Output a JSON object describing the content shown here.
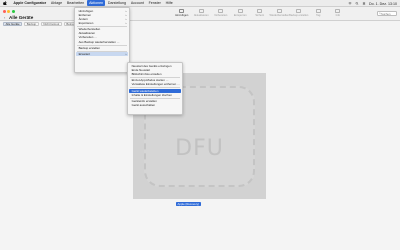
{
  "menubar": {
    "app_name": "Apple Configurator",
    "items": [
      "Ablage",
      "Bearbeiten",
      "Aktionen",
      "Darstellung",
      "Account",
      "Fenster",
      "Hilfe"
    ],
    "clock": "Do. 1. Dez. 13:10"
  },
  "window": {
    "title": "Alle Geräte",
    "toolbar": [
      {
        "label": "Hinzufügen",
        "dim": false
      },
      {
        "label": "Aktualisieren",
        "dim": true
      },
      {
        "label": "Vorbereiten",
        "dim": true
      },
      {
        "label": "Entsperren",
        "dim": true
      },
      {
        "label": "Sichern",
        "dim": true
      },
      {
        "label": "Wiederherstellen",
        "dim": true
      },
      {
        "label": "Backup erstellen",
        "dim": true
      },
      {
        "label": "Tag",
        "dim": true
      },
      {
        "label": "Info",
        "dim": true
      }
    ],
    "search_placeholder": "Suchen"
  },
  "filters": [
    "Alle Geräte",
    "Backup",
    "Nicht betreut",
    "Betreut",
    "Wiederherst.",
    "Sonstige"
  ],
  "primary_menu": [
    {
      "label": "Hinzufügen",
      "arrow": true,
      "dim": false
    },
    {
      "label": "Entfernen",
      "arrow": true,
      "dim": false
    },
    {
      "label": "Ändern",
      "arrow": true,
      "dim": false
    },
    {
      "label": "Exportieren",
      "arrow": true,
      "dim": false
    },
    {
      "sep": true
    },
    {
      "label": "Wiederherstellen",
      "arrow": false,
      "dim": false
    },
    {
      "label": "Aktualisieren",
      "arrow": false,
      "dim": false
    },
    {
      "label": "Vorbereiten …",
      "arrow": false,
      "dim": false
    },
    {
      "label": "Aus Backup wiederherstellen …",
      "arrow": false,
      "dim": false
    },
    {
      "sep": true
    },
    {
      "label": "Backup erstellen",
      "arrow": false,
      "dim": false
    },
    {
      "sep": true
    },
    {
      "label": "Erweitert",
      "arrow": true,
      "dim": false,
      "active": true
    }
  ],
  "submenu": [
    {
      "label": "Neustart des Geräts erzwingen",
      "dim": false
    },
    {
      "label": "Ende Neustart",
      "dim": false
    },
    {
      "label": "Bildschirmfoto erstellen",
      "dim": false
    },
    {
      "sep": true
    },
    {
      "label": "Einzel-App-Modus starten …",
      "dim": false
    },
    {
      "label": "Verwaltete Einstellungen entfernen …",
      "dim": false
    },
    {
      "sep": true
    },
    {
      "label": "Gerät wiederbeleben",
      "highlight": true
    },
    {
      "label": "Inhalte & Einstellungen löschen",
      "dim": false
    },
    {
      "sep": true
    },
    {
      "label": "Geräteinfo erstellen",
      "dim": false
    },
    {
      "label": "Gerät ausschalten",
      "dim": false
    }
  ],
  "device": {
    "mode_text": "DFU",
    "label": "Apple (Recovery)"
  }
}
